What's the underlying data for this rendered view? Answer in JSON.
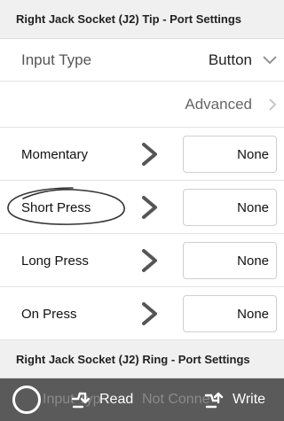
{
  "section1": {
    "title": "Right Jack Socket (J2) Tip - Port Settings"
  },
  "input_type": {
    "label": "Input Type",
    "value": "Button"
  },
  "advanced": {
    "label": "Advanced"
  },
  "mappings": [
    {
      "label": "Momentary",
      "value": "None"
    },
    {
      "label": "Short Press",
      "value": "None"
    },
    {
      "label": "Long Press",
      "value": "None"
    },
    {
      "label": "On Press",
      "value": "None"
    }
  ],
  "section2": {
    "title": "Right Jack Socket (J2) Ring - Port Settings"
  },
  "toolbar": {
    "ghost_label": "Input Typ",
    "status": "Not Conne",
    "read_label": "Read",
    "write_label": "Write"
  }
}
